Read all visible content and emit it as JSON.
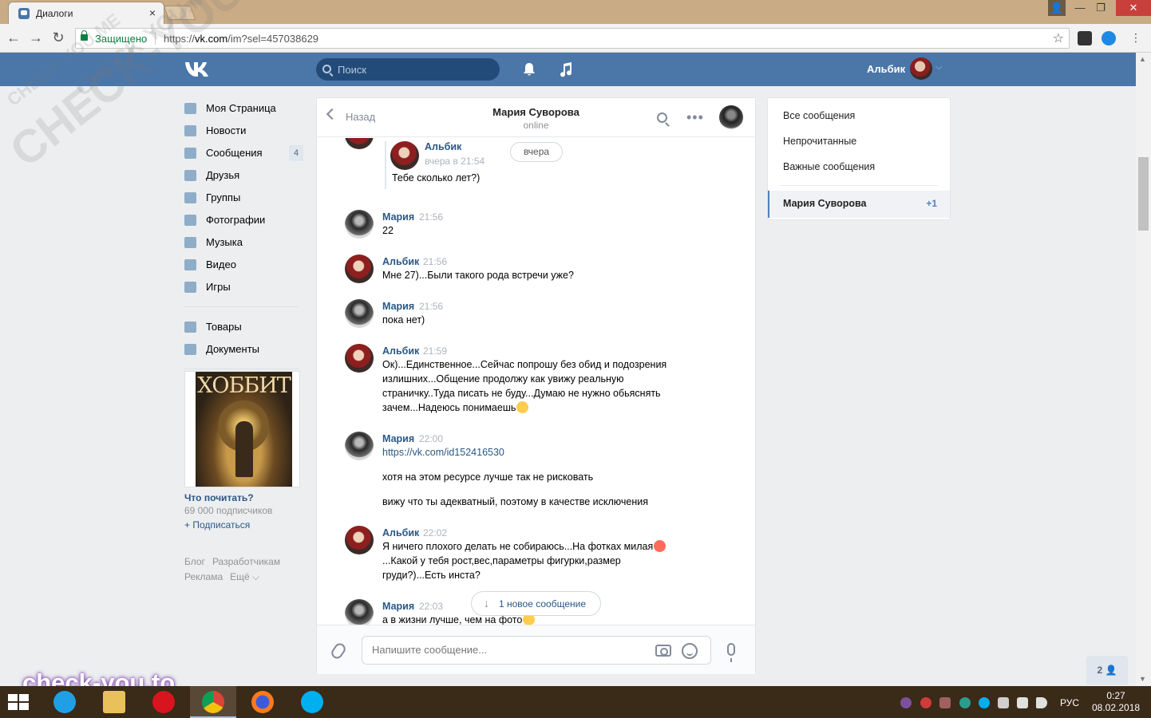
{
  "browser": {
    "tab_title": "Диалоги",
    "tab_close": "×",
    "secure_label": "Защищено",
    "url_scheme": "https://",
    "url_host": "vk.com",
    "url_path": "/im?sel=457038629",
    "bookmark_star": "☆",
    "back": "←",
    "forward": "→",
    "reload": "↻",
    "window_controls": {
      "user": "👤",
      "minimize": "—",
      "maximize": "❐",
      "close": "✕"
    }
  },
  "header": {
    "search_placeholder": "Поиск",
    "user_name": "Альбик",
    "chevron": "⌵"
  },
  "sidebar": {
    "items": [
      {
        "label": "Моя Страница",
        "icon": "home-icon"
      },
      {
        "label": "Новости",
        "icon": "news-icon"
      },
      {
        "label": "Сообщения",
        "icon": "messages-icon",
        "count": "4"
      },
      {
        "label": "Друзья",
        "icon": "friend-icon"
      },
      {
        "label": "Группы",
        "icon": "groups-icon"
      },
      {
        "label": "Фотографии",
        "icon": "camera-icon"
      },
      {
        "label": "Музыка",
        "icon": "music-icon"
      },
      {
        "label": "Видео",
        "icon": "video-icon"
      },
      {
        "label": "Игры",
        "icon": "gamepad-icon"
      }
    ],
    "items2": [
      {
        "label": "Товары",
        "icon": "bag-icon"
      },
      {
        "label": "Документы",
        "icon": "document-icon"
      }
    ],
    "ad": {
      "cover_text": "ХОББИТ",
      "title": "Что почитать?",
      "subscribers": "69 000 подписчиков",
      "subscribe": "+ Подписаться"
    },
    "footer": [
      "Блог",
      "Разработчикам",
      "Реклама",
      "Ещё ⌵"
    ]
  },
  "chat": {
    "back_label": "Назад",
    "peer_name": "Мария Суворова",
    "peer_status": "online",
    "more": "•••",
    "date_pill": "вчера",
    "forwarded": {
      "author": "Альбик",
      "time": "вчера в 21:54",
      "text": "Тебе сколько лет?)"
    },
    "messages": [
      {
        "author": "Мария",
        "time": "21:56",
        "lines": [
          "22"
        ]
      },
      {
        "author": "Альбик",
        "time": "21:56",
        "lines": [
          "Мне 27)...Были такого рода встречи уже?"
        ]
      },
      {
        "author": "Мария",
        "time": "21:56",
        "lines": [
          "пока нет)"
        ]
      },
      {
        "author": "Альбик",
        "time": "21:59",
        "lines": [
          "Ок)...Единственное...Сейчас попрошу без обид и подозрения",
          "излишних...Общение продолжу как увижу реальную",
          "страничку..Туда писать не буду...Думаю не нужно обьяснять",
          "зачем...Надеюсь понимаешь"
        ]
      },
      {
        "author": "Мария",
        "time": "22:00",
        "link": "https://vk.com/id152416530",
        "lines": [
          "хотя на этом ресурсе лучше так не рисковать",
          "вижу что ты адекватный, поэтому в качестве исключения"
        ]
      },
      {
        "author": "Альбик",
        "time": "22:02",
        "lines": [
          "Я ничего плохого делать не собираюсь...На фотках милая",
          "...Какой у тебя рост,вес,параметры фигурки,размер",
          "груди?)...Есть инста?"
        ]
      },
      {
        "author": "Мария",
        "time": "22:03",
        "lines": [
          "а в жизни лучше, чем на фото"
        ]
      }
    ],
    "new_message_pill": "1 новое сообщение",
    "new_message_arrow": "↓",
    "composer_placeholder": "Напишите сообщение..."
  },
  "right_panel": {
    "links": [
      "Все сообщения",
      "Непрочитанные",
      "Важные сообщения"
    ],
    "selected_dialog": "Мария Суворова",
    "selected_count": "+1"
  },
  "online_friends": "2 👤",
  "watermark_bottom": "check-you.to",
  "watermark_diag": [
    "CHECK-YOU.ME",
    "CHECK-YOU.ME",
    "CHECK-YOU.ME"
  ],
  "taskbar": {
    "lang": "РУС",
    "time": "0:27",
    "date": "08.02.2018"
  },
  "colors": {
    "vk_blue": "#4a76a8",
    "link_blue": "#2a5885",
    "titlebar": "#c9ab86",
    "taskbar": "#3a2a18"
  }
}
